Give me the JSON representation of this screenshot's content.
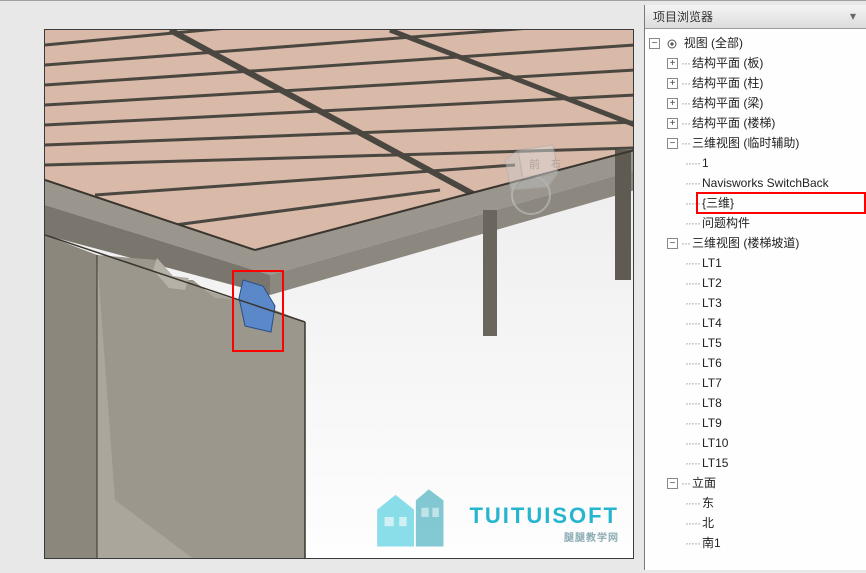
{
  "viewport": {
    "controls": {
      "min": "—",
      "max": "□",
      "close": "×"
    }
  },
  "sidebar": {
    "title": "项目浏览器",
    "tree": {
      "root": {
        "label": "视图 (全部)",
        "icon": "views"
      },
      "struct1": "结构平面 (板)",
      "struct2": "结构平面 (柱)",
      "struct3": "结构平面 (梁)",
      "struct4": "结构平面 (楼梯)",
      "view3d_aux": "三维视图 (临时辅助)",
      "aux1": "1",
      "aux_nav": "Navisworks SwitchBack",
      "aux_3d": "{三维}",
      "aux_problem": "问题构件",
      "view3d_stair": "三维视图 (楼梯坡道)",
      "lt1": "LT1",
      "lt2": "LT2",
      "lt3": "LT3",
      "lt4": "LT4",
      "lt5": "LT5",
      "lt6": "LT6",
      "lt7": "LT7",
      "lt8": "LT8",
      "lt9": "LT9",
      "lt10": "LT10",
      "lt15": "LT15",
      "elevation": "立面",
      "e_east": "东",
      "e_north": "北",
      "e_south1": "南1"
    }
  },
  "watermark": {
    "brand": "TUITUISOFT",
    "sub": "腿腿教学网"
  },
  "colors": {
    "highlight": "#ff0000",
    "brand": "#00a9c7"
  }
}
